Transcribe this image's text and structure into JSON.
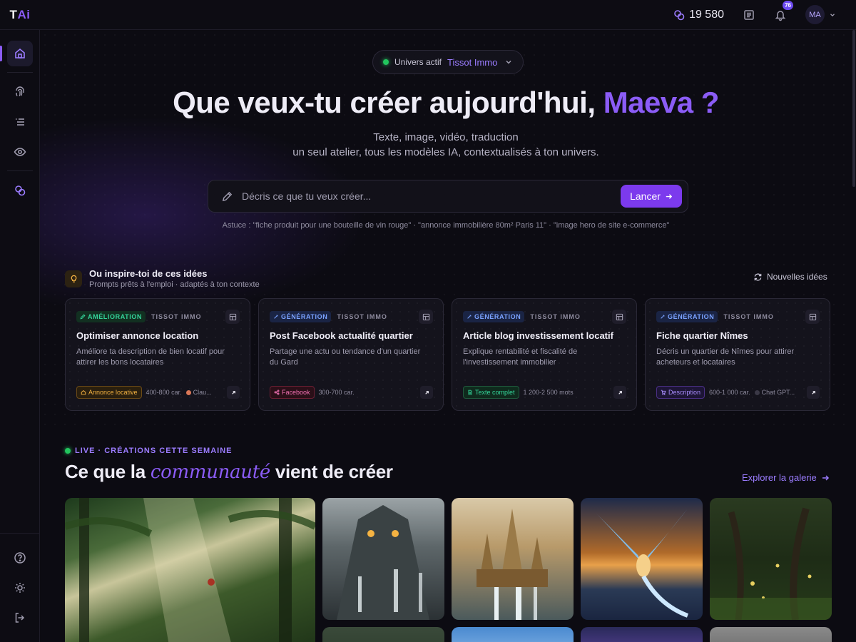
{
  "app": {
    "logo_prefix": "T",
    "logo_accent": "Ai"
  },
  "topbar": {
    "credits": "19 580",
    "notifications_count": "76",
    "avatar_initials": "MA"
  },
  "universe": {
    "label": "Univers actif",
    "value": "Tissot Immo"
  },
  "hero": {
    "title_prefix": "Que veux-tu créer aujourd'hui, ",
    "title_name": "Maeva ?",
    "subtitle_line1": "Texte, image, vidéo, traduction",
    "subtitle_line2": "un seul atelier, tous les modèles IA, contextualisés à ton univers."
  },
  "prompt": {
    "placeholder": "Décris ce que tu veux créer...",
    "button_label": "Lancer"
  },
  "tip": "Astuce : \"fiche produit pour une bouteille de vin rouge\" · \"annonce immobilière 80m² Paris 11\" · \"image hero de site e-commerce\"",
  "ideas": {
    "title": "Ou inspire-toi de ces idées",
    "subtitle": "Prompts prêts à l'emploi · adaptés à ton contexte",
    "refresh_label": "Nouvelles idées",
    "cards": [
      {
        "category": "AMÉLIORATION",
        "org": "TISSOT IMMO",
        "title": "Optimiser annonce location",
        "description": "Améliore ta description de bien locatif pour attirer les bons locataires",
        "type": "Annonce locative",
        "length": "400-800 car.",
        "model": "Clau..."
      },
      {
        "category": "GÉNÉRATION",
        "org": "TISSOT IMMO",
        "title": "Post Facebook actualité quartier",
        "description": "Partage une actu ou tendance d'un quartier du Gard",
        "type": "Facebook",
        "length": "300-700 car.",
        "model": ""
      },
      {
        "category": "GÉNÉRATION",
        "org": "TISSOT IMMO",
        "title": "Article blog investissement locatif",
        "description": "Explique rentabilité et fiscalité de l'investissement immobilier",
        "type": "Texte complet",
        "length": "1 200-2 500 mots",
        "model": ""
      },
      {
        "category": "GÉNÉRATION",
        "org": "TISSOT IMMO",
        "title": "Fiche quartier Nîmes",
        "description": "Décris un quartier de Nîmes pour attirer acheteurs et locataires",
        "type": "Description",
        "length": "600-1 000 car.",
        "model": "Chat GPT..."
      }
    ]
  },
  "community": {
    "live_label": "LIVE · CRÉATIONS CETTE SEMAINE",
    "title_prefix": "Ce que la ",
    "title_italic": "communauté",
    "title_suffix": " vient de créer",
    "explore_label": "Explorer la galerie"
  },
  "colors": {
    "accent": "#8b5cf6",
    "background": "#0c0b12",
    "live": "#22c55e"
  }
}
